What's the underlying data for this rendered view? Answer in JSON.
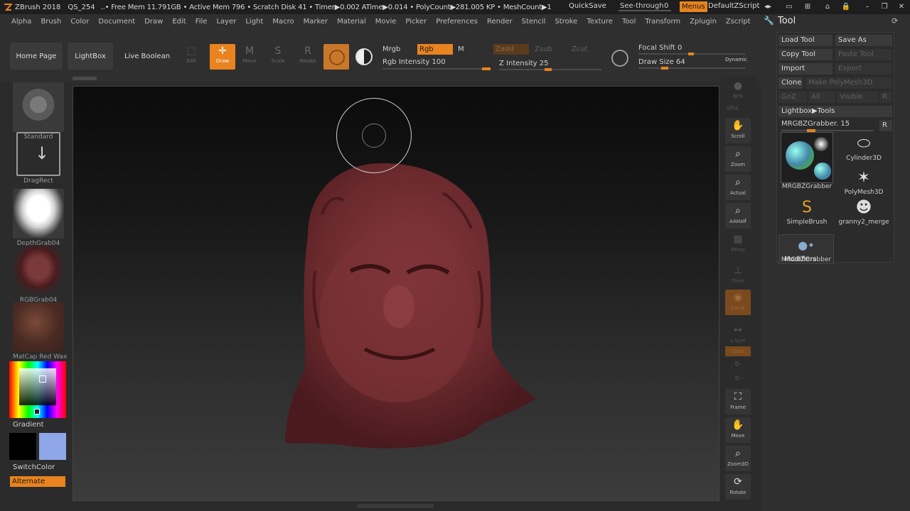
{
  "titlebar": {
    "app": "ZBrush 2018",
    "doc": "QS_254",
    "stats": "..• Free Mem 11.791GB • Active Mem 796 • Scratch Disk 41 • Timer▶0.002 ATime▶0.014 • PolyCount▶281.005 KP • MeshCount▶1",
    "quicksave": "QuickSave",
    "seethrough_label": "See-through",
    "seethrough_value": "0",
    "menus": "Menus",
    "zscript": "DefaultZScript"
  },
  "menubar": [
    "Alpha",
    "Brush",
    "Color",
    "Document",
    "Draw",
    "Edit",
    "File",
    "Layer",
    "Light",
    "Macro",
    "Marker",
    "Material",
    "Movie",
    "Picker",
    "Preferences",
    "Render",
    "Stencil",
    "Stroke",
    "Texture",
    "Tool",
    "Transform",
    "Zplugin",
    "Zscript"
  ],
  "shelf": {
    "home": "Home Page",
    "lightbox": "LightBox",
    "liveboolean": "Live Boolean",
    "tools": [
      {
        "label": "Edit",
        "glyph": "⬚"
      },
      {
        "label": "Draw",
        "glyph": "✛"
      },
      {
        "label": "Move",
        "glyph": "M"
      },
      {
        "label": "Scale",
        "glyph": "S"
      },
      {
        "label": "Rotate",
        "glyph": "R"
      }
    ],
    "mrgb": "Mrgb",
    "rgb": "Rgb",
    "m": "M",
    "rgb_intensity": "Rgb Intensity 100",
    "zadd": "Zadd",
    "zsub": "Zsub",
    "zcut": "Zcut",
    "z_intensity": "Z Intensity 25",
    "focal_shift": "Focal Shift 0",
    "draw_size": "Draw Size 64",
    "dynamic": "Dynamic",
    "rgb_intensity_value": 1.0,
    "z_intensity_value": 0.25
  },
  "leftshelf": {
    "brush": "Standard",
    "stroke": "DragRect",
    "alpha1": "DepthGrab04",
    "alpha2": "RGBGrab04",
    "material": "MatCap Red Wax",
    "gradient": "Gradient",
    "switchcolor": "SwitchColor",
    "alternate": "Alternate"
  },
  "rightshelf": {
    "bpr": "BPR",
    "spix": "SPix",
    "buttons": [
      "Scroll",
      "Zoom",
      "Actual",
      "AAHalf",
      "Persp",
      "Floor",
      "Local",
      "L.Sym",
      "Qxyz",
      "Frame",
      "Move",
      "Zoom3D",
      "Rotate"
    ]
  },
  "toolpanel": {
    "title": "Tool",
    "load": "Load Tool",
    "saveas": "Save As",
    "copy": "Copy Tool",
    "paste": "Paste Tool",
    "import": "Import",
    "export": "Export",
    "clone": "Clone",
    "makepoly": "Make PolyMesh3D",
    "goz": "GoZ",
    "all": "All",
    "visible": "Visible",
    "r": "R",
    "lightbox_tools": "Lightbox▶Tools",
    "current_tool": "MRGBZGrabber. 15",
    "items": [
      "MRGBZGrabber",
      "Cylinder3D",
      "PolyMesh3D",
      "SimpleBrush",
      "granny2_merge",
      "MRGBZGrabber"
    ],
    "modifiers": "Modifiers"
  },
  "colors": {
    "accent": "#e8831f",
    "primary_color": "#000000",
    "secondary_color": "#8fa6e8",
    "model": "#6b2a2e"
  }
}
